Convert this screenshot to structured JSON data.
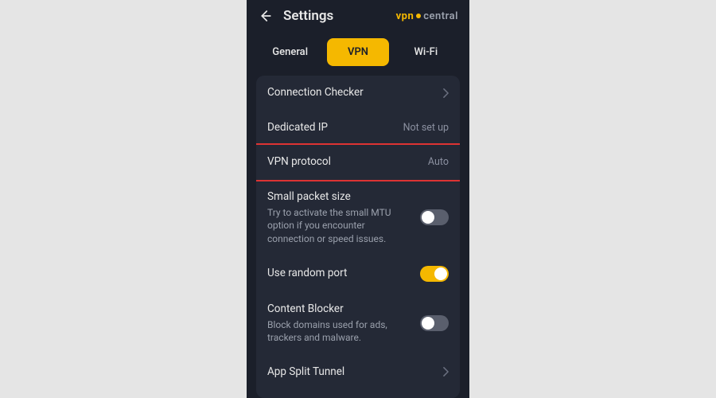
{
  "header": {
    "title": "Settings",
    "logo_prefix": "vpn",
    "logo_suffix": "central"
  },
  "tabs": {
    "general": "General",
    "vpn": "VPN",
    "wifi": "Wi-Fi",
    "active": "vpn"
  },
  "rows": {
    "connection_checker": {
      "title": "Connection Checker"
    },
    "dedicated_ip": {
      "title": "Dedicated IP",
      "value": "Not set up"
    },
    "vpn_protocol": {
      "title": "VPN protocol",
      "value": "Auto",
      "highlighted": true
    },
    "small_packet": {
      "title": "Small packet size",
      "subtitle": "Try to activate the small MTU option if you encounter connection or speed issues.",
      "enabled": false
    },
    "random_port": {
      "title": "Use random port",
      "enabled": true
    },
    "content_blocker": {
      "title": "Content Blocker",
      "subtitle": "Block domains used for ads, trackers and malware.",
      "enabled": false
    },
    "app_split_tunnel": {
      "title": "App Split Tunnel"
    }
  }
}
